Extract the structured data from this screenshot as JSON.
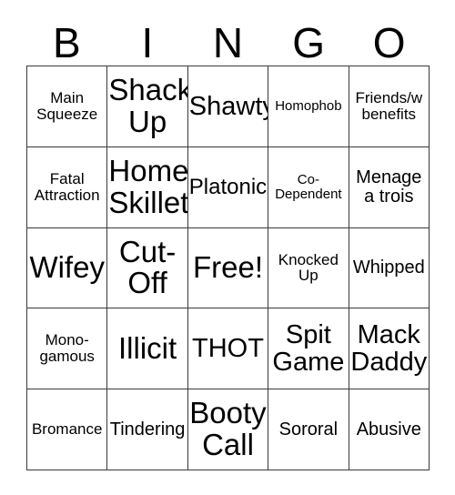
{
  "card": {
    "title": "BINGO",
    "header_letters": [
      "B",
      "I",
      "N",
      "G",
      "O"
    ],
    "free_space_label": "Free!",
    "rows": [
      [
        {
          "text": "Main\nSqueeze",
          "size": "sz-s"
        },
        {
          "text": "Shack\nUp",
          "size": "sz-xxl"
        },
        {
          "text": "Shawty",
          "size": "sz-xl"
        },
        {
          "text": "Homophob",
          "size": "sz-xs"
        },
        {
          "text": "Friends/w\nbenefits",
          "size": "sz-s"
        }
      ],
      [
        {
          "text": "Fatal\nAttraction",
          "size": "sz-s"
        },
        {
          "text": "Home\nSkillet",
          "size": "sz-xxl"
        },
        {
          "text": "Platonic",
          "size": "sz-l"
        },
        {
          "text": "Co-\nDependent",
          "size": "sz-xs"
        },
        {
          "text": "Menage\na trois",
          "size": "sz-m"
        }
      ],
      [
        {
          "text": "Wifey",
          "size": "sz-xxl"
        },
        {
          "text": "Cut-\nOff",
          "size": "sz-xxl"
        },
        {
          "text": "Free!",
          "size": "sz-xxl"
        },
        {
          "text": "Knocked\nUp",
          "size": "sz-s"
        },
        {
          "text": "Whipped",
          "size": "sz-m"
        }
      ],
      [
        {
          "text": "Mono-\ngamous",
          "size": "sz-s"
        },
        {
          "text": "Illicit",
          "size": "sz-xxl"
        },
        {
          "text": "THOT",
          "size": "sz-xl"
        },
        {
          "text": "Spit\nGame",
          "size": "sz-xl"
        },
        {
          "text": "Mack\nDaddy",
          "size": "sz-xl"
        }
      ],
      [
        {
          "text": "Bromance",
          "size": "sz-s"
        },
        {
          "text": "Tindering",
          "size": "sz-m"
        },
        {
          "text": "Booty\nCall",
          "size": "sz-xxl"
        },
        {
          "text": "Sororal",
          "size": "sz-m"
        },
        {
          "text": "Abusive",
          "size": "sz-m"
        }
      ]
    ]
  },
  "colors": {
    "background": "#ffffff",
    "text": "#000000",
    "grid_line": "#3a3a3a"
  }
}
